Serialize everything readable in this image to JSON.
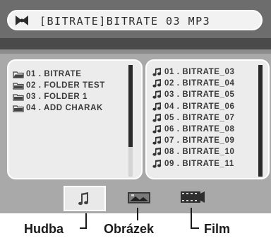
{
  "title_bar": {
    "text": "[BITRATE]BITRATE 03 MP3",
    "icon": "disc-icon"
  },
  "folders": [
    {
      "label": "01 . BITRATE",
      "icon": "folder-open-icon"
    },
    {
      "label": "02 . FOLDER TEST",
      "icon": "folder-icon"
    },
    {
      "label": "03 . FOLDER 1",
      "icon": "folder-icon"
    },
    {
      "label": "04 . ADD CHARAK",
      "icon": "folder-icon"
    }
  ],
  "files": [
    {
      "label": "01 . BITRATE_03",
      "icon": "music-note-icon"
    },
    {
      "label": "02 . BITRATE_04",
      "icon": "music-note-icon"
    },
    {
      "label": "03 . BITRATE_05",
      "icon": "music-note-icon"
    },
    {
      "label": "04 . BITRATE_06",
      "icon": "music-note-icon"
    },
    {
      "label": "05 . BITRATE_07",
      "icon": "music-note-icon"
    },
    {
      "label": "06 . BITRATE_08",
      "icon": "music-note-icon"
    },
    {
      "label": "07 . BITRATE_09",
      "icon": "music-note-icon"
    },
    {
      "label": "08 . BITRATE_10",
      "icon": "music-note-icon"
    },
    {
      "label": "09 . BITRATE_11",
      "icon": "music-note-icon"
    }
  ],
  "tabs": [
    {
      "id": "music",
      "icon": "music-note-icon",
      "selected": true
    },
    {
      "id": "photo",
      "icon": "photo-icon",
      "selected": false
    },
    {
      "id": "film",
      "icon": "film-icon",
      "selected": false
    }
  ],
  "callouts": {
    "music": "Hudba",
    "photo": "Obrázek",
    "film": "Film"
  },
  "colors": {
    "screen_bg": "#a9a9a9",
    "header_bg": "#6d6d6d",
    "panel_bg": "#ececec",
    "text": "#3a3a3a"
  }
}
